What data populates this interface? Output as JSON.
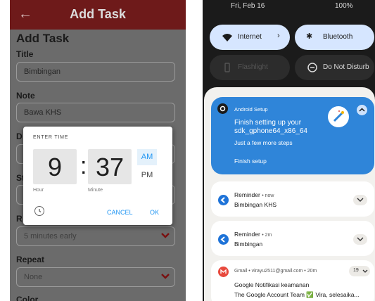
{
  "left_app": {
    "app_title": "Add Task",
    "header": "Add Task",
    "title_label": "Title",
    "title_value": "Bimbingan",
    "note_label": "Note",
    "note_value": "Bawa KHS",
    "date_label_partial": "D",
    "start_label_partial": "St",
    "remind_label_partial": "R",
    "remind_value": "5 minutes early",
    "repeat_label": "Repeat",
    "repeat_value": "None",
    "color_label": "Color"
  },
  "time_dialog": {
    "header": "ENTER TIME",
    "hour": "9",
    "separator": ":",
    "minute": "37",
    "am": "AM",
    "pm": "PM",
    "hour_label": "Hour",
    "minute_label": "Minute",
    "cancel": "CANCEL",
    "ok": "OK",
    "selected_period": "AM"
  },
  "right_phone": {
    "status_time": "Fri, Feb 16",
    "status_battery": "100%",
    "tiles": [
      {
        "label": "Internet",
        "icon": "wifi-icon",
        "active": true
      },
      {
        "label": "Bluetooth",
        "icon": "bluetooth-icon",
        "active": true
      },
      {
        "label": "Flashlight",
        "icon": "flashlight-icon",
        "active": false
      },
      {
        "label": "Do Not Disturb",
        "icon": "dnd-icon",
        "active": false
      }
    ],
    "setup_card": {
      "app": "Android Setup",
      "title": "Finish setting up your sdk_gphone64_x86_64",
      "subtitle": "Just a few more steps",
      "action": "Finish setup"
    },
    "notifications": [
      {
        "app": "Reminder",
        "time": "• now",
        "text": "Bimbingan KHS"
      },
      {
        "app": "Reminder",
        "time": "• 2m",
        "text": "Bimbingan"
      }
    ],
    "gmail": {
      "meta": "Gmail • virayu2511@gmail.com • 20m",
      "count": "19",
      "title": "Google Notifikasi keamanan",
      "body": "The Google Account Team ✅ Vira, selesaika..."
    }
  },
  "colors": {
    "appbar": "#6e1a1a",
    "accent": "#2196f3",
    "setup_card": "#2f85d9",
    "tile_active": "#d6e6ff"
  }
}
